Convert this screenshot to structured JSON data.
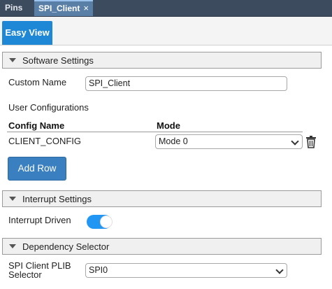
{
  "tabs": {
    "pins": "Pins",
    "spi_client": "SPI_Client",
    "close_glyph": "×"
  },
  "view_tab": "Easy View",
  "software_settings": {
    "title": "Software Settings",
    "custom_name_label": "Custom Name",
    "custom_name_value": "SPI_Client",
    "user_configurations_label": "User Configurations",
    "table": {
      "headers": [
        "Config Name",
        "Mode"
      ],
      "rows": [
        {
          "config_name": "CLIENT_CONFIG",
          "mode": "Mode 0"
        }
      ]
    },
    "add_row_label": "Add Row"
  },
  "interrupt_settings": {
    "title": "Interrupt Settings",
    "interrupt_driven_label": "Interrupt Driven",
    "interrupt_driven_on": true
  },
  "dependency_selector": {
    "title": "Dependency Selector",
    "plib_selector_label_line1": "SPI Client PLIB",
    "plib_selector_label_line2": "Selector",
    "plib_selector_value": "SPI0"
  },
  "colors": {
    "accent": "#1f88d6",
    "tab_bar": "#3d4b5f",
    "active_tab": "#5a7fa7",
    "button": "#3a7fbf",
    "toggle_on": "#2196f3"
  }
}
